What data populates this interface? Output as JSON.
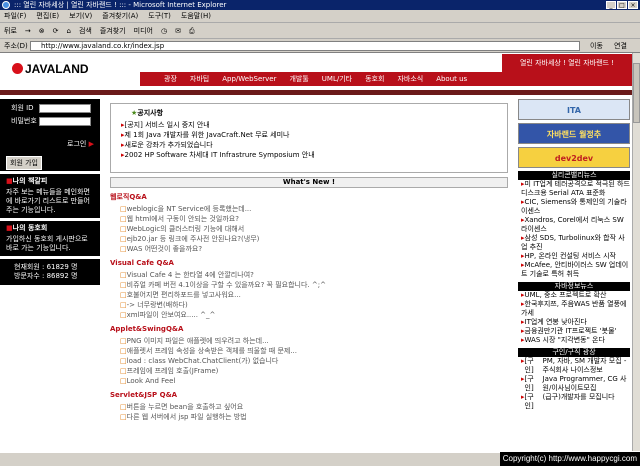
{
  "window": {
    "title": "::: 열린 자바세상 | 열린 자바랜드 ! ::: - Microsoft Internet Explorer",
    "buttons": [
      "_",
      "□",
      "×"
    ]
  },
  "menu": [
    "파일(F)",
    "편집(E)",
    "보기(V)",
    "즐겨찾기(A)",
    "도구(T)",
    "도움말(H)"
  ],
  "toolbar": [
    "뒤로",
    "→",
    "⊗",
    "⟳",
    "⌂",
    "검색",
    "즐겨찾기",
    "미디어",
    "◷",
    "✉",
    "⎙"
  ],
  "address": {
    "label": "주소(D)",
    "url": "http://www.javaland.co.kr/index.jsp",
    "go": "이동",
    "links": "연결"
  },
  "site": {
    "logo": "JAVALAND",
    "slogan": "열린 자바세상 ! 열린 자바랜드 !",
    "nav": [
      "광장",
      "자바팁",
      "App/WebServer",
      "개발툴",
      "UML/기타",
      "동호회",
      "자바소식",
      "About us"
    ],
    "login": {
      "id_label": "회원 ID",
      "pw_label": "비밀번호",
      "login_label": "로그인",
      "join_label": "회원 가입"
    },
    "box1": {
      "title": "나의 책갈피",
      "text": "자주 보는 메뉴들을 메인화면에 바로가기 리스트로 만들어주는 기능입니다."
    },
    "box2": {
      "title": "나의 동호회",
      "text": "가입하신 동호회 게시판으로 바로 가는 기능입니다."
    },
    "stats": [
      "현재회원 : 61829 명",
      "방문자수 : 86892 명"
    ],
    "notice": {
      "title": "공지사항",
      "items": [
        "[공지] 서비스 일시 중지 안내",
        "제 1회 Java 개발자를 위한 JavaCraft.Net 무료 세미나",
        "새로운 강좌가 추가되었습니다",
        "2002 HP Software 차세대 IT Infrastrure Symposium 안내"
      ]
    },
    "whatsnew": "What's New !",
    "sections": [
      {
        "title": "웹로직Q&A",
        "items": [
          "weblogic을 NT Service에 등록했는데...",
          "웹 html에서 구동이 안되는 것일까요?",
          "WebLogic의 클러스터링 기능에 대해서",
          "ejb20.jar 등 링크에 주사전 안된나요?(냉무)",
          "WAS 어떤것이 좋을까요?"
        ]
      },
      {
        "title": "Visual Cafe Q&A",
        "items": [
          "Visual Cafe 4 는 한타열 4에 안깔리나여?",
          "비쥬얼 카페 버전 4.1이상을 구할 수 있을까요? 꼭 필요합니다. ^;^",
          "호불어지면 편리하포드를 넣고사워요...",
          "-> 너무랑변(배하다)",
          "xml파일이 안보여요..... ^_^"
        ]
      },
      {
        "title": "Applet&SwingQ&A",
        "items": [
          "PNG 이미지 파일은 애플렛에 띄우려고 하는데...",
          "애플렛서 프레임 속성을 상속받은 객체를 띄울할 때 문제...",
          "load : class WebChat.ChatClient(가) 없습니다",
          "프레임에 프레임 호출(JFrame)",
          "Look And Feel"
        ]
      },
      {
        "title": "Servlet&JSP Q&A",
        "items": [
          "버튼을 누르면 bean을 호출하고 싶어요",
          "다른 웹 서버에서 jsp 파일 실행하는 방법"
        ]
      }
    ],
    "banners": [
      {
        "text": "ITA",
        "color": "#3366aa"
      },
      {
        "text": "자바랜드 월정추",
        "color": "#c03030"
      },
      {
        "text": "dev2dev",
        "color": "#e08a10"
      }
    ],
    "news_title": "실리콘밸리뉴스",
    "news": [
      "미 IT업계 테러공격으로 적극된 하드디스크용 Serial ATA 표준화",
      "CIC, Siemens와 통제인의 기술라이센스",
      "Xandros, Corel에서 리눅스 SW 라이센스",
      "삼성 SDS, Turbolinux와 합작 사업 추진",
      "HP, 온라인 컨설팅 서비스 시작",
      "McAfee, 안티바이러스 SW 업데이트 기술로 특허 취득"
    ],
    "news2_title": "자바정보뉴스",
    "news2": [
      "UML, 중소 프로젝트로 확산",
      "한국후지쯔, 주음WAS 반품 열풍에 가세",
      "IT업계 연봉 낮아진다",
      "금융권만기관 IT프로젝트 '봇물'",
      "WAS 시장 \"지각변동\" 온다"
    ],
    "jobs_title": "구인/구직 광장",
    "jobs": [
      {
        "tag": "[구인]",
        "text": "PM, 자바, SM 개발자 모집 - 주식회사 나이스정보"
      },
      {
        "tag": "[구인]",
        "text": "Java Programmer, CG 사원/이사님이트모집"
      },
      {
        "tag": "[구인]",
        "text": "(급구)개발자를 모집니다"
      }
    ],
    "copyright": "Copyright(c) http://www.happycgi.com"
  }
}
